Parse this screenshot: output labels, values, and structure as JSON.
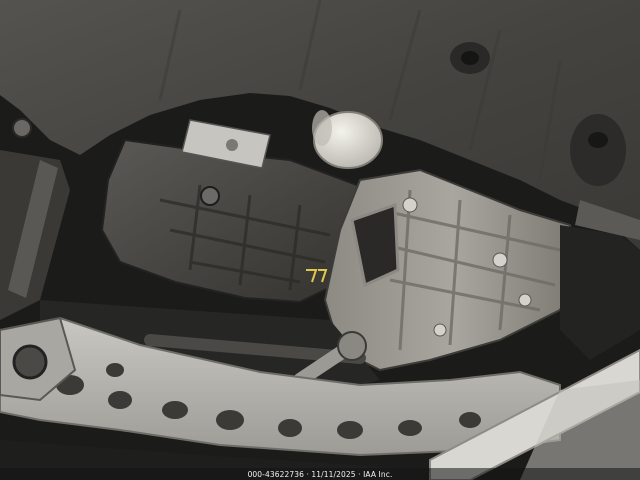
{
  "photo": {
    "subject": "Vehicle undercarriage photographed from below",
    "watermark": "000-43622736 · 11/11/2025 · IAA Inc."
  },
  "palette": {
    "shield": "#4a4947",
    "shield_dark": "#2f2e2c",
    "oil_pan": "#4c4b48",
    "transmission": "#9a9791",
    "crossmember": "#b8b6b1",
    "oil_filter": "#e2e0d8",
    "shadow": "#111111"
  }
}
